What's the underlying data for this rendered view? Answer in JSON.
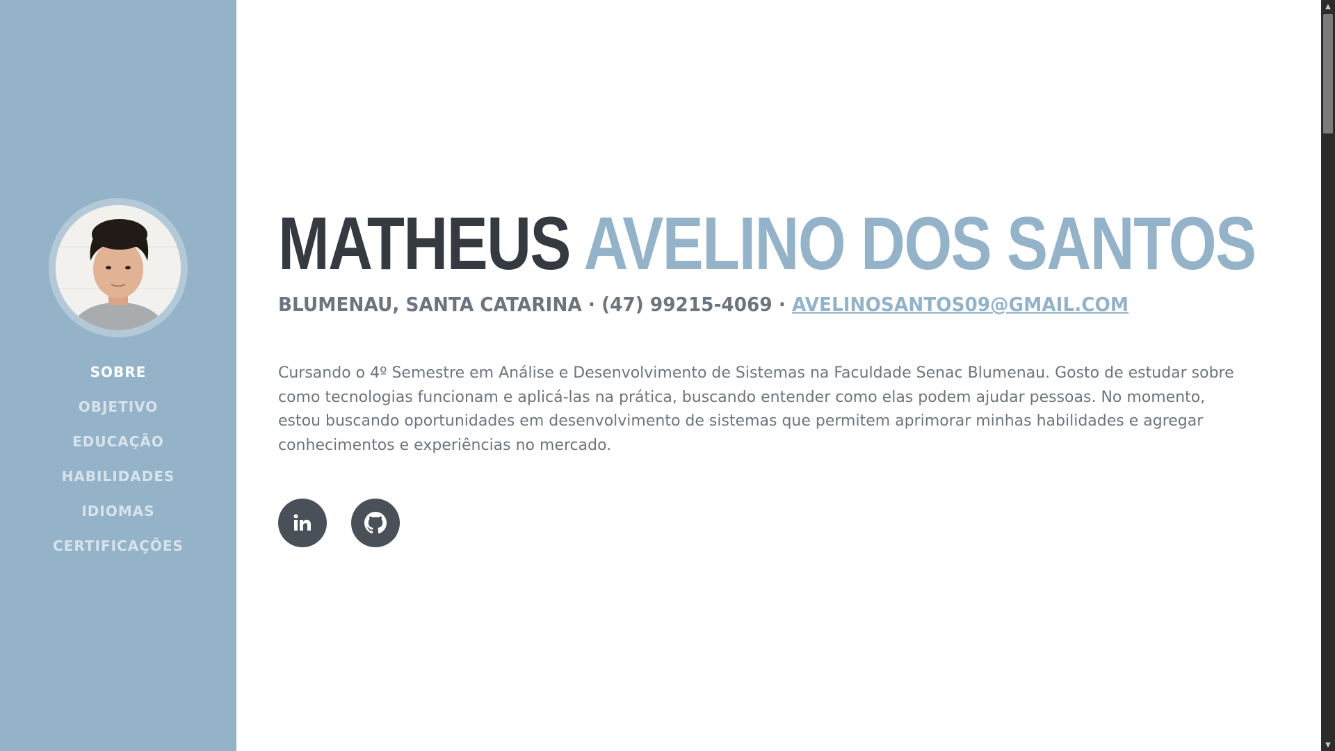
{
  "profile": {
    "first_name": "MATHEUS",
    "last_name": "AVELINO DOS SANTOS",
    "location": "BLUMENAU, SANTA CATARINA",
    "separator": "·",
    "phone": "(47) 99215-4069",
    "email": "AVELINOSANTOS09@GMAIL.COM",
    "bio": "Cursando o 4º Semestre em Análise e Desenvolvimento de Sistemas na Faculdade Senac Blumenau. Gosto de estudar sobre como tecnologias funcionam e aplicá-las na prática, buscando entender como elas podem ajudar pessoas. No momento, estou buscando oportunidades em desenvolvimento de sistemas que permitem aprimorar minhas habilidades e agregar conhecimentos e experiências no mercado."
  },
  "sidebar": {
    "avatar_icon": "profile-photo",
    "nav": [
      {
        "label": "SOBRE",
        "active": true
      },
      {
        "label": "OBJETIVO",
        "active": false
      },
      {
        "label": "EDUCAÇÃO",
        "active": false
      },
      {
        "label": "HABILIDADES",
        "active": false
      },
      {
        "label": "IDIOMAS",
        "active": false
      },
      {
        "label": "CERTIFICAÇÕES",
        "active": false
      }
    ]
  },
  "socials": [
    {
      "icon": "linkedin-icon"
    },
    {
      "icon": "github-icon"
    }
  ],
  "colors": {
    "sidebar_bg": "#95b3c8",
    "accent": "#95b3c8",
    "dark_text": "#343a40",
    "body_text": "#6c757d",
    "social_bg": "#495057"
  }
}
